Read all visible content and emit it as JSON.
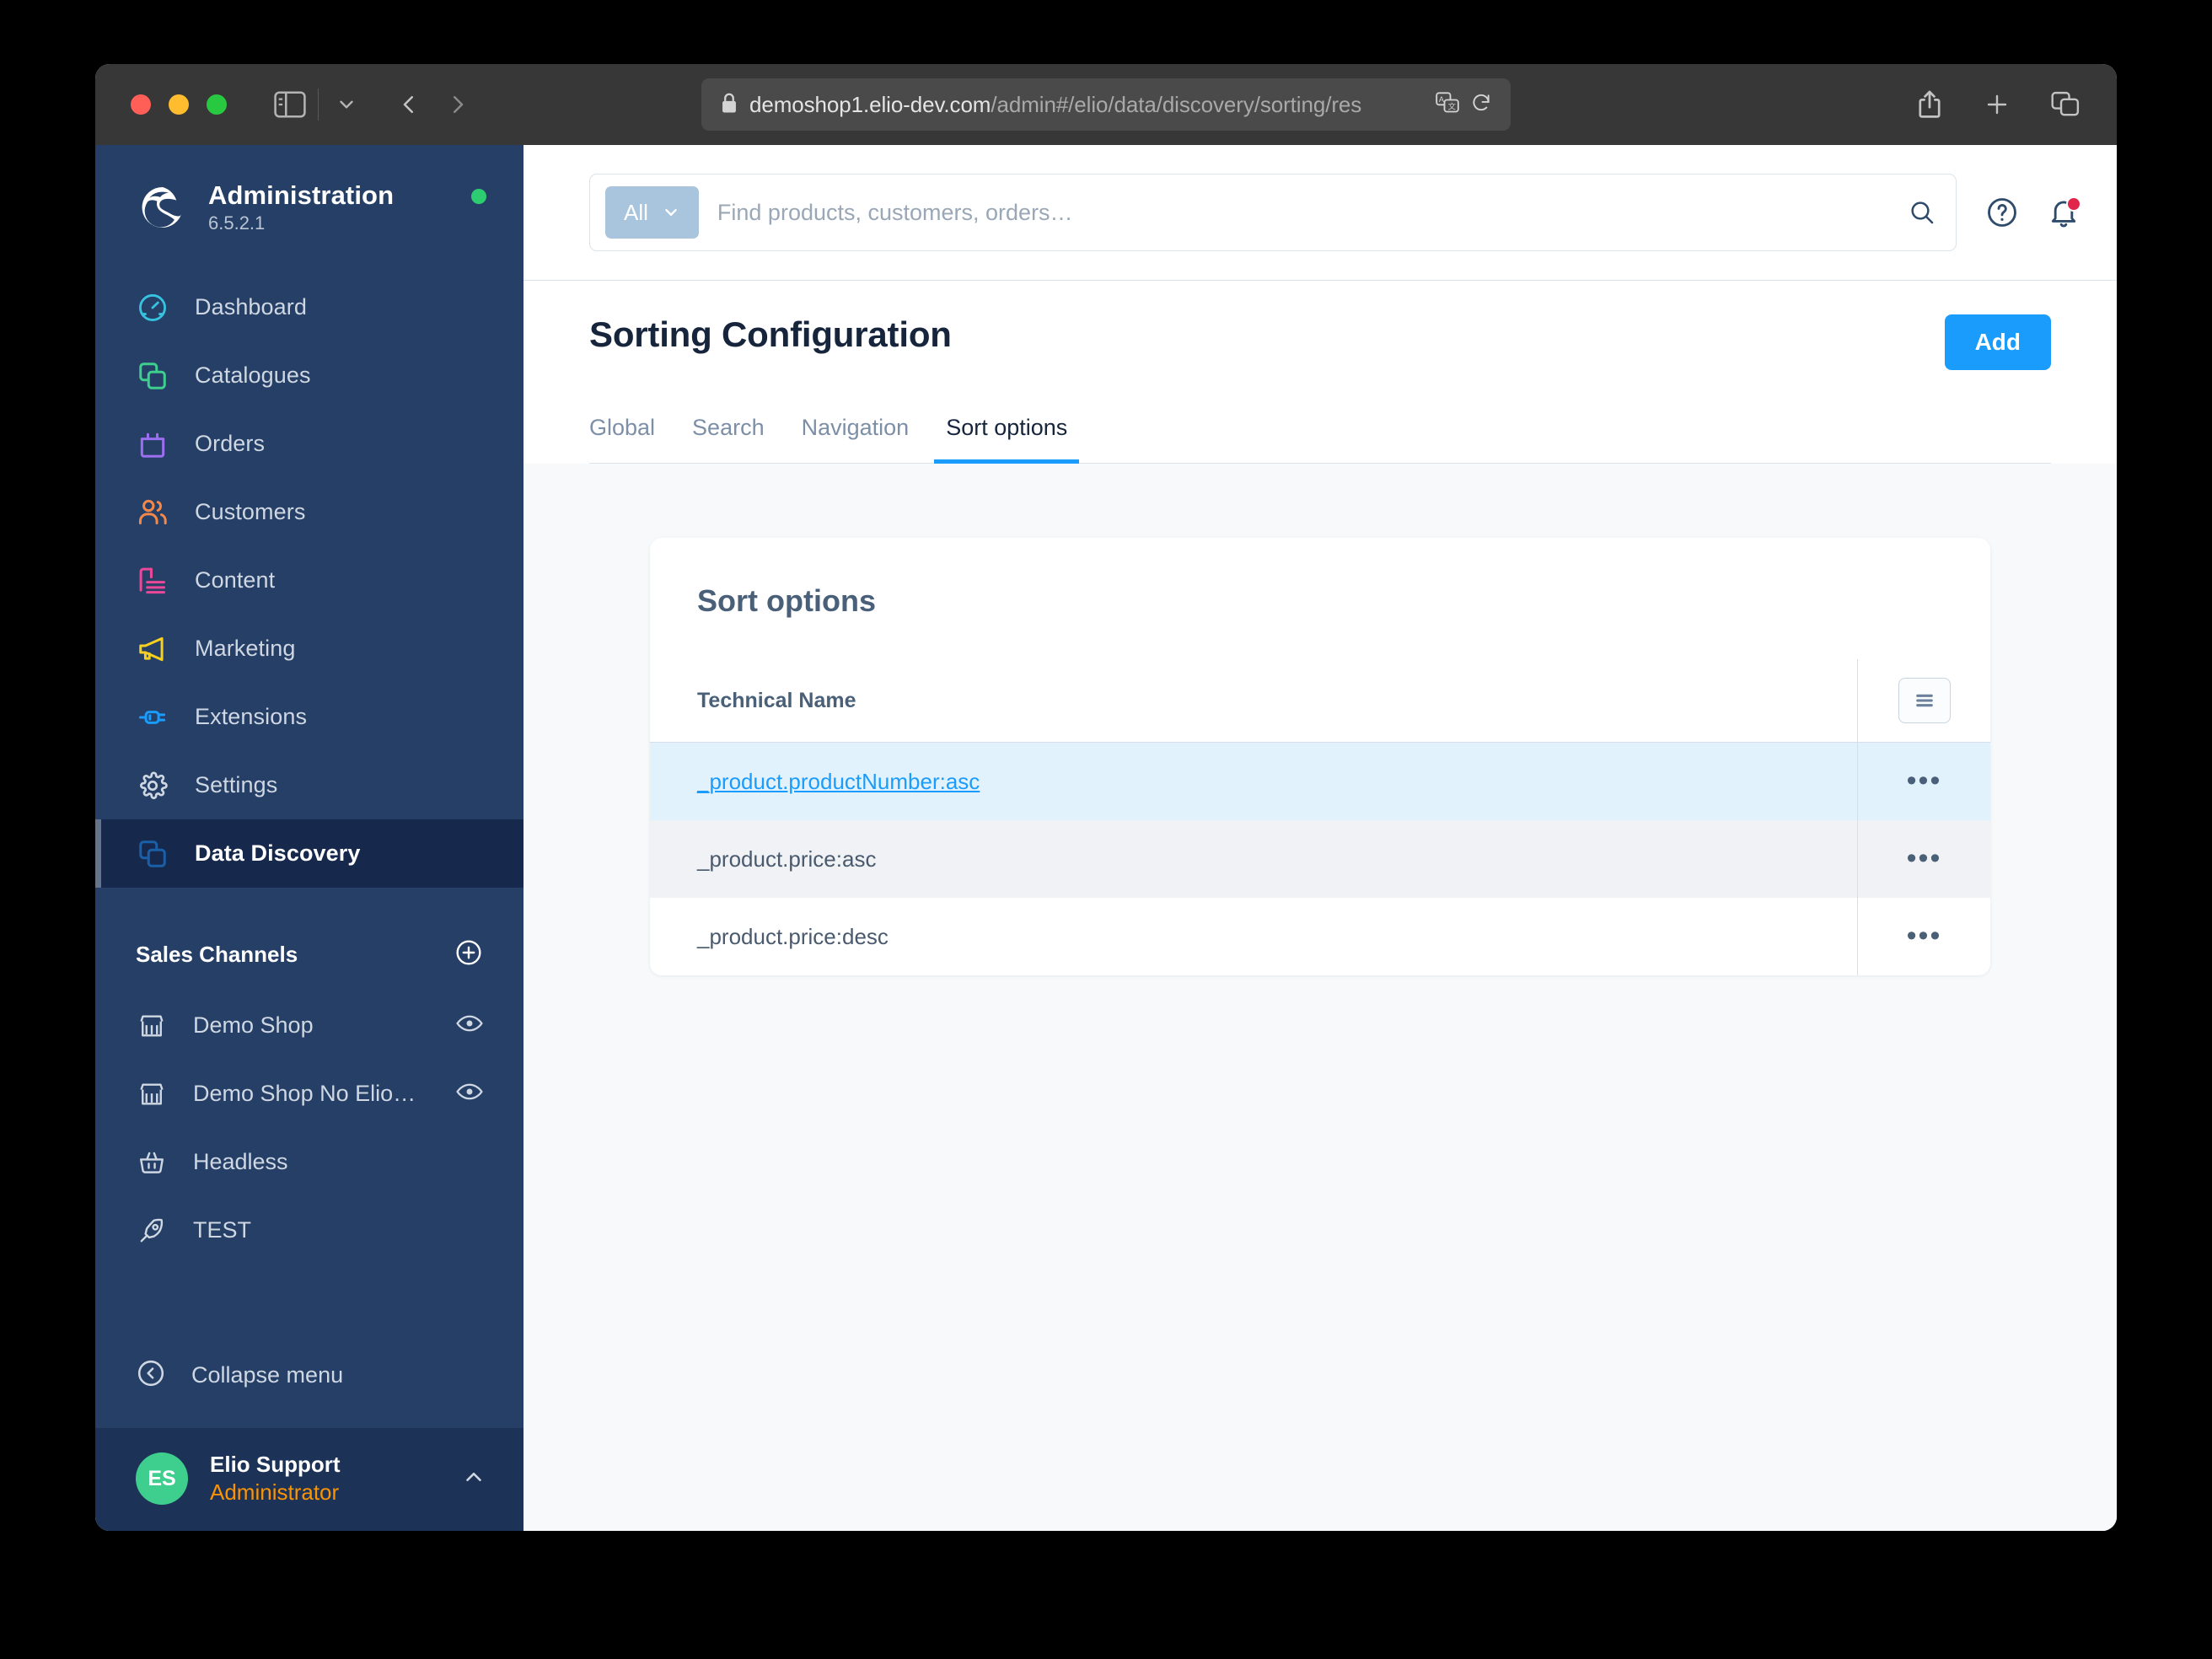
{
  "browser": {
    "url_secure_host": "demoshop1.elio-dev.com",
    "url_path": "/admin#/elio/data/discovery/sorting/res",
    "icons": {
      "sidebar_toggle": "sidebar-toggle-icon",
      "dropdown": "chevron-down-icon",
      "back": "back-arrow-icon",
      "forward": "forward-arrow-icon",
      "lock": "lock-icon",
      "translate": "translate-icon",
      "reload": "reload-icon",
      "share": "share-icon",
      "new_tab": "plus-icon",
      "tab_overview": "tab-overview-icon"
    }
  },
  "sidebar": {
    "title": "Administration",
    "version": "6.5.2.1",
    "status_color": "#2ecc71",
    "nav_items": [
      {
        "label": "Dashboard",
        "icon": "gauge-icon",
        "color": "#37c2e0",
        "active": false
      },
      {
        "label": "Catalogues",
        "icon": "copy-icon",
        "color": "#3ecf8e",
        "active": false
      },
      {
        "label": "Orders",
        "icon": "bag-icon",
        "color": "#9b6ff0",
        "active": false
      },
      {
        "label": "Customers",
        "icon": "users-icon",
        "color": "#f2884b",
        "active": false
      },
      {
        "label": "Content",
        "icon": "content-icon",
        "color": "#ec4899",
        "active": false
      },
      {
        "label": "Marketing",
        "icon": "megaphone-icon",
        "color": "#f5d020",
        "active": false
      },
      {
        "label": "Extensions",
        "icon": "plug-icon",
        "color": "#1a9cfc",
        "active": false
      },
      {
        "label": "Settings",
        "icon": "gear-icon",
        "color": "#cfd7e3",
        "active": false
      },
      {
        "label": "Data Discovery",
        "icon": "copy-icon",
        "color": "#1a5fa8",
        "active": true
      }
    ],
    "section_title": "Sales Channels",
    "section_add_icon": "plus-circle-icon",
    "channels": [
      {
        "label": "Demo Shop",
        "icon": "store-icon",
        "trailing_icon": "eye-icon"
      },
      {
        "label": "Demo Shop No ElioSear…",
        "icon": "store-icon",
        "trailing_icon": "eye-icon"
      },
      {
        "label": "Headless",
        "icon": "basket-icon",
        "trailing_icon": ""
      },
      {
        "label": "TEST",
        "icon": "rocket-icon",
        "trailing_icon": ""
      }
    ],
    "collapse_label": "Collapse menu",
    "collapse_icon": "collapse-left-icon",
    "user": {
      "initials": "ES",
      "name": "Elio Support",
      "role": "Administrator",
      "avatar_color": "#3ecf8e",
      "role_color": "#f89406",
      "chevron_icon": "chevron-up-icon"
    }
  },
  "topbar": {
    "scope_label": "All",
    "scope_chevron_icon": "chevron-down-icon",
    "search_placeholder": "Find products, customers, orders…",
    "search_value": "",
    "search_icon": "search-icon",
    "help_icon": "help-circle-icon",
    "notifications_icon": "bell-icon",
    "notifications_badge_color": "#e0274b"
  },
  "page": {
    "title": "Sorting Configuration",
    "add_label": "Add",
    "accent_color": "#1a9cfc",
    "tabs": [
      {
        "label": "Global",
        "active": false
      },
      {
        "label": "Search",
        "active": false
      },
      {
        "label": "Navigation",
        "active": false
      },
      {
        "label": "Sort options",
        "active": true
      }
    ]
  },
  "card": {
    "title": "Sort options",
    "config_button_icon": "list-settings-icon",
    "columns": [
      "Technical Name"
    ],
    "rows": [
      {
        "technical_name": "_product.productNumber:asc",
        "style": "highlight",
        "is_link": true,
        "actions_icon": "context-menu-icon"
      },
      {
        "technical_name": "_product.price:asc",
        "style": "alt",
        "is_link": false,
        "actions_icon": "context-menu-icon"
      },
      {
        "technical_name": "_product.price:desc",
        "style": "plain",
        "is_link": false,
        "actions_icon": "context-menu-icon"
      }
    ]
  }
}
